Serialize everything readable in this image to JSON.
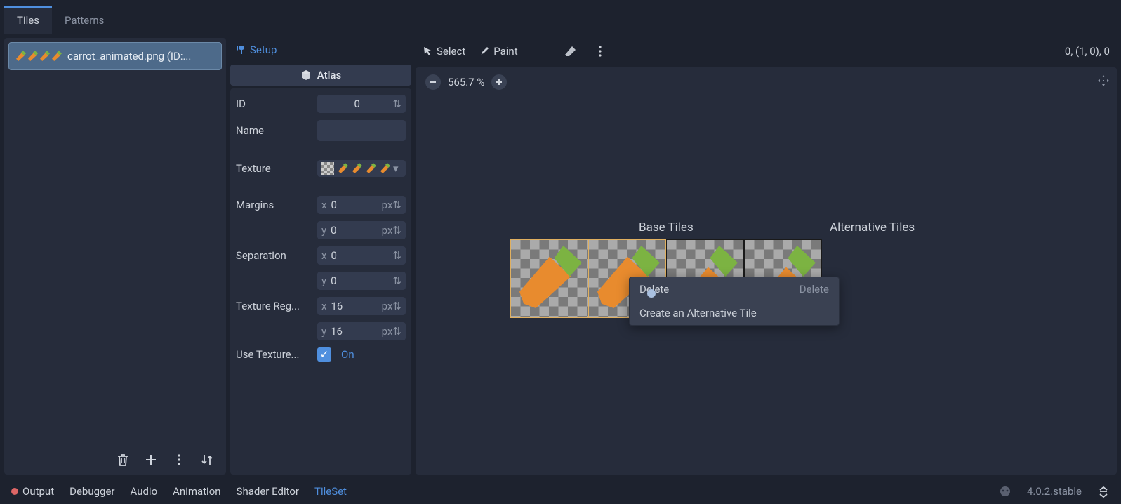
{
  "top_tabs": {
    "tiles": "Tiles",
    "patterns": "Patterns"
  },
  "source_list": {
    "item0": {
      "label": "carrot_animated.png (ID:..."
    }
  },
  "modes": {
    "setup": "Setup",
    "select": "Select",
    "paint": "Paint"
  },
  "coord_readout": "0, (1, 0), 0",
  "atlas": {
    "header": "Atlas",
    "id_label": "ID",
    "id_value": "0",
    "name_label": "Name",
    "texture_label": "Texture",
    "margins_label": "Margins",
    "margins_x": "0",
    "margins_y": "0",
    "separation_label": "Separation",
    "sep_x": "0",
    "sep_y": "0",
    "region_label": "Texture Reg...",
    "reg_x": "16",
    "reg_y": "16",
    "px": "px",
    "use_tex_label": "Use Texture...",
    "on": "On"
  },
  "viewport": {
    "zoom": "565.7 %",
    "base_tiles": "Base Tiles",
    "alt_tiles": "Alternative Tiles"
  },
  "context_menu": {
    "title": "Delete",
    "hint": "Delete",
    "item_create_alt": "Create an Alternative Tile"
  },
  "bottom": {
    "output": "Output",
    "debugger": "Debugger",
    "audio": "Audio",
    "animation": "Animation",
    "shader": "Shader Editor",
    "tileset": "TileSet",
    "version": "4.0.2.stable"
  }
}
